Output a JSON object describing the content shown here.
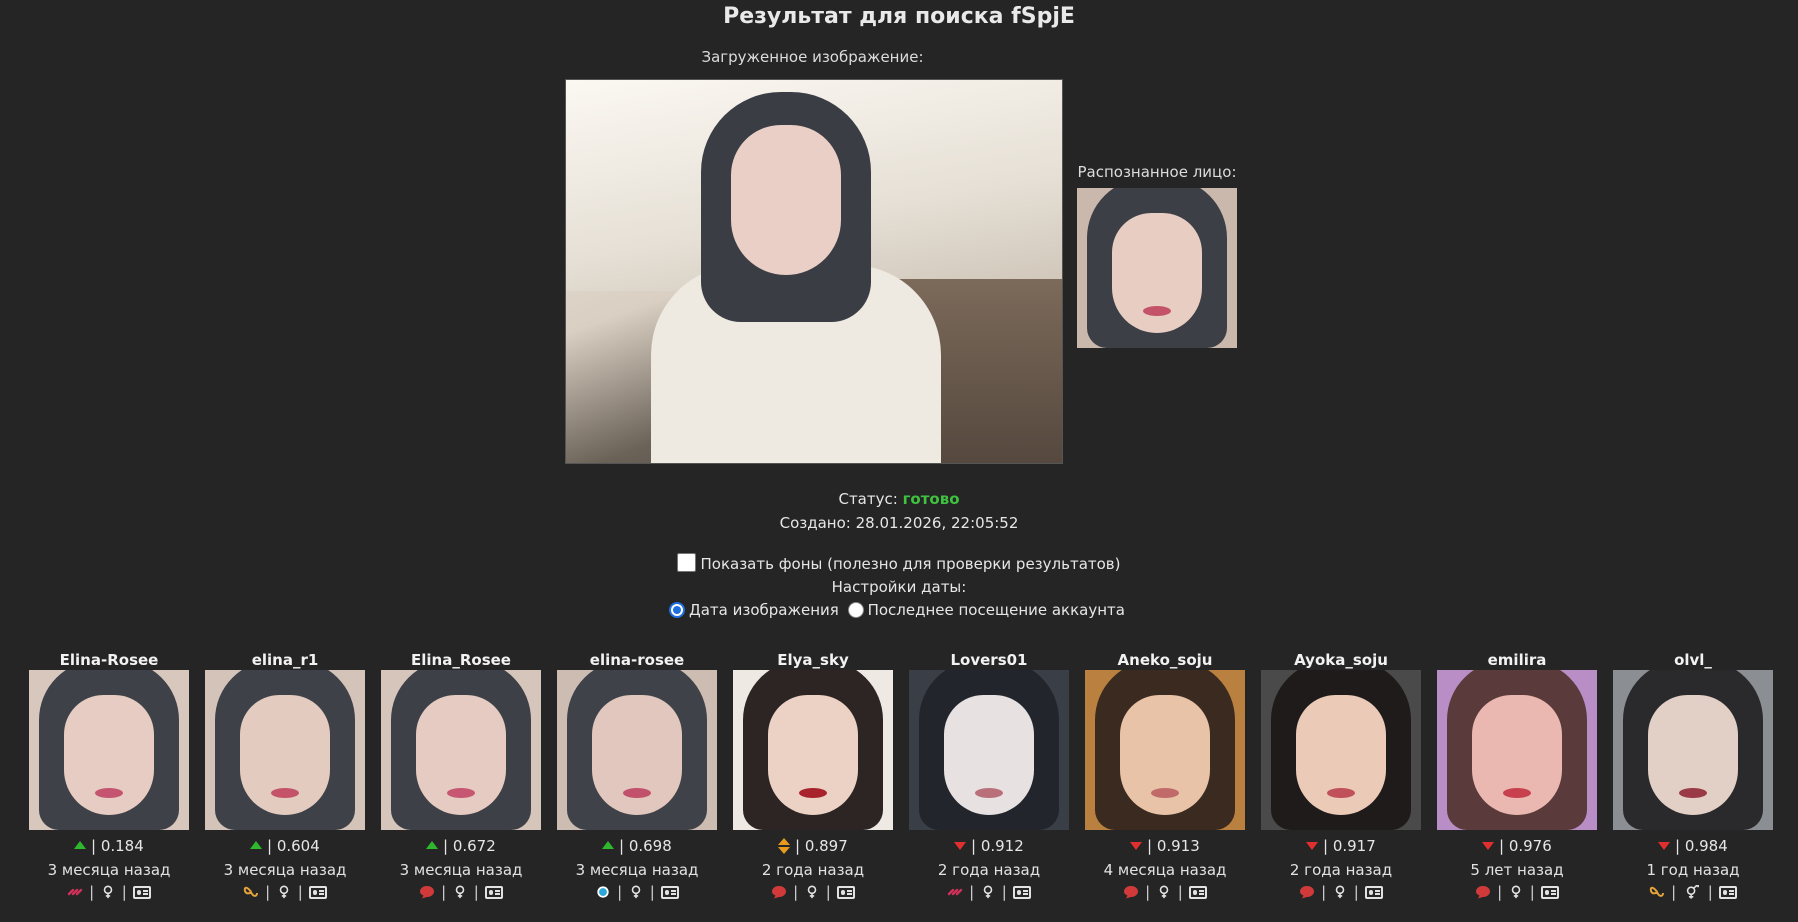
{
  "page": {
    "title": "Результат для поиска fSpjE",
    "uploaded_label": "Загруженное изображение:",
    "face_label": "Распознанное лицо:",
    "status_label": "Статус:",
    "status_value": "готово",
    "created": "Создано: 28.01.2026, 22:05:52",
    "show_backgrounds_label": "Показать фоны (полезно для проверки результатов)",
    "date_settings_label": "Настройки даты:",
    "radio_image_date": "Дата изображения",
    "radio_last_visit": "Последнее посещение аккаунта"
  },
  "colors": {
    "background": "#252525",
    "status_ready": "#3fc23f",
    "arrow_up": "#2db82d",
    "arrow_down": "#e03030",
    "arrow_mixed": "#e89a1f",
    "radio_selected": "#1f6fe0"
  },
  "results": [
    {
      "name": "Elina-Rosee",
      "trend": "up",
      "score": "0.184",
      "date": "3 месяца назад",
      "source_icon": "link-icon",
      "gender_icon": "female-icon",
      "sep": "|"
    },
    {
      "name": "elina_r1",
      "trend": "up",
      "score": "0.604",
      "date": "3 месяца назад",
      "source_icon": "butterfly-icon",
      "gender_icon": "female-icon",
      "sep": "|"
    },
    {
      "name": "Elina_Rosee",
      "trend": "up",
      "score": "0.672",
      "date": "3 месяца назад",
      "source_icon": "chat-bubble-icon",
      "gender_icon": "female-icon",
      "sep": "|"
    },
    {
      "name": "elina-rosee",
      "trend": "up",
      "score": "0.698",
      "date": "3 месяца назад",
      "source_icon": "circle-icon",
      "gender_icon": "female-icon",
      "sep": "|"
    },
    {
      "name": "Elya_sky",
      "trend": "mixed",
      "score": "0.897",
      "date": "2 года назад",
      "source_icon": "chat-bubble-icon",
      "gender_icon": "female-icon",
      "sep": "|"
    },
    {
      "name": "Lovers01",
      "trend": "down",
      "score": "0.912",
      "date": "2 года назад",
      "source_icon": "link-icon",
      "gender_icon": "female-icon",
      "sep": "|"
    },
    {
      "name": "Aneko_soju",
      "trend": "down",
      "score": "0.913",
      "date": "4 месяца назад",
      "source_icon": "chat-bubble-icon",
      "gender_icon": "female-icon",
      "sep": "|"
    },
    {
      "name": "Ayoka_soju",
      "trend": "down",
      "score": "0.917",
      "date": "2 года назад",
      "source_icon": "chat-bubble-icon",
      "gender_icon": "female-icon",
      "sep": "|"
    },
    {
      "name": "emilira",
      "trend": "down",
      "score": "0.976",
      "date": "5 лет назад",
      "source_icon": "chat-bubble-icon",
      "gender_icon": "female-icon",
      "sep": "|"
    },
    {
      "name": "olvl_",
      "trend": "down",
      "score": "0.984",
      "date": "1 год назад",
      "source_icon": "butterfly-icon",
      "gender_icon": "male-female-icon",
      "sep": "|"
    }
  ]
}
